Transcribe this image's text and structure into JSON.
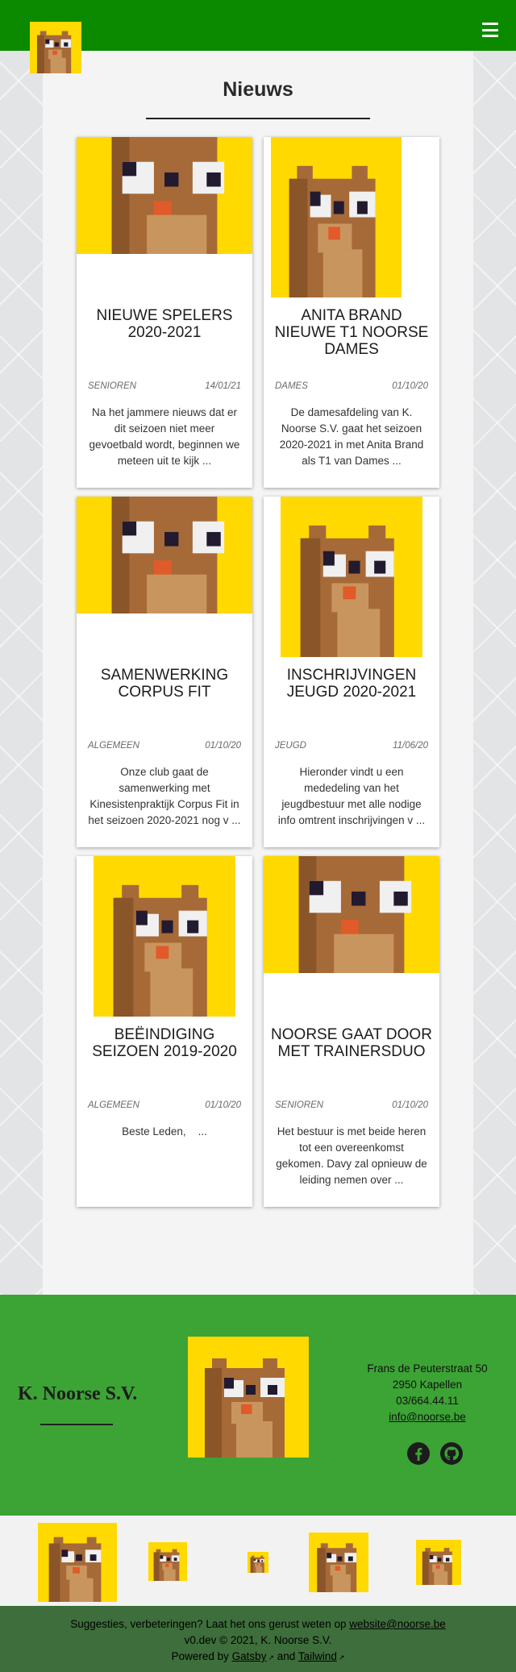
{
  "page": {
    "title": "Nieuws"
  },
  "colors": {
    "header_green": "#0b8a00",
    "footer_green": "#3ca335",
    "bottom_bar": "#3d6e3b",
    "mascot_yellow": "#ffd900"
  },
  "icons": {
    "menu": "hamburger-icon",
    "facebook": "facebook-icon",
    "github": "github-icon",
    "external": "external-link-icon"
  },
  "articles": [
    {
      "title": "NIEUWE SPELERS 2020-2021",
      "category": "SENIOREN",
      "date": "14/01/21",
      "excerpt": "Na het jammere nieuws dat er dit seizoen niet meer gevoetbald wordt, beginnen we meteen uit te kijk ..."
    },
    {
      "title": "ANITA BRAND NIEUWE T1 NOORSE DAMES",
      "category": "DAMES",
      "date": "01/10/20",
      "excerpt": "De damesafdeling van K. Noorse S.V. gaat het seizoen 2020-2021 in met Anita Brand als T1 van Dames ..."
    },
    {
      "title": "SAMENWERKING CORPUS FIT",
      "category": "ALGEMEEN",
      "date": "01/10/20",
      "excerpt": "Onze club gaat de samenwerking met Kinesistenpraktijk Corpus Fit in het seizoen 2020-2021 nog v ..."
    },
    {
      "title": "INSCHRIJVINGEN JEUGD 2020-2021",
      "category": "JEUGD",
      "date": "11/06/20",
      "excerpt": "Hieronder vindt u een mededeling van het jeugdbestuur met alle nodige info omtrent inschrijvingen v ..."
    },
    {
      "title": "BEËINDIGING SEIZOEN 2019-2020",
      "category": "ALGEMEEN",
      "date": "01/10/20",
      "excerpt": "Beste Leden,    ..."
    },
    {
      "title": "NOORSE GAAT DOOR MET TRAINERSDUO",
      "category": "SENIOREN",
      "date": "01/10/20",
      "excerpt": "Het bestuur is met beide heren tot een overeenkomst gekomen. Davy zal opnieuw de leiding nemen over ..."
    }
  ],
  "footer": {
    "club_name": "K. Noorse S.V.",
    "address_line1": "Frans de Peuterstraat 50",
    "address_line2": "2950 Kapellen",
    "phone": "03/664.44.11",
    "email": "info@noorse.be"
  },
  "bottom": {
    "suggestion_text": "Suggesties, verbeteringen? Laat het ons gerust weten op",
    "suggestion_email": "website@noorse.be",
    "version_text": "v0.dev © 2021, K. Noorse S.V.",
    "powered_text": "Powered by",
    "gatsby": "Gatsby",
    "and_text": "and",
    "tailwind": "Tailwind"
  }
}
